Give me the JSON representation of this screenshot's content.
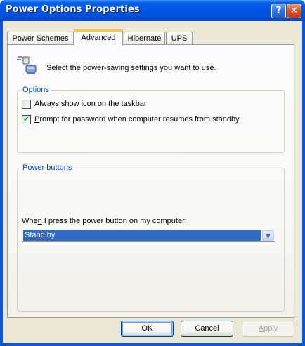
{
  "window": {
    "title": "Power Options Properties",
    "help_glyph": "?",
    "close_glyph": "✕"
  },
  "tabs": [
    {
      "label": "Power Schemes",
      "active": false
    },
    {
      "label": "Advanced",
      "active": true
    },
    {
      "label": "Hibernate",
      "active": false
    },
    {
      "label": "UPS",
      "active": false
    }
  ],
  "advanced": {
    "intro_text": "Select the power-saving settings you want to use.",
    "intro_icon": "power-settings-icon",
    "options": {
      "title": "Options",
      "show_icon": {
        "label_pre": "Alway",
        "label_accel": "s",
        "label_post": " show icon on the taskbar",
        "checked": false
      },
      "prompt_password": {
        "label_pre": "",
        "label_accel": "P",
        "label_post": "rompt for password when computer resumes from standby",
        "checked": true
      }
    },
    "power_buttons": {
      "title": "Power buttons",
      "power_button_label_pre": "Whe",
      "power_button_label_accel": "n",
      "power_button_label_post": " I press the power button on my computer:",
      "power_button_action": "Stand by"
    }
  },
  "buttons": {
    "ok": "OK",
    "cancel": "Cancel",
    "apply_accel": "A",
    "apply_rest": "pply"
  },
  "colors": {
    "titlebar": "#0054e3",
    "group_title": "#0046d5",
    "selection": "#316ac5",
    "dialog_bg": "#ece9d8"
  }
}
